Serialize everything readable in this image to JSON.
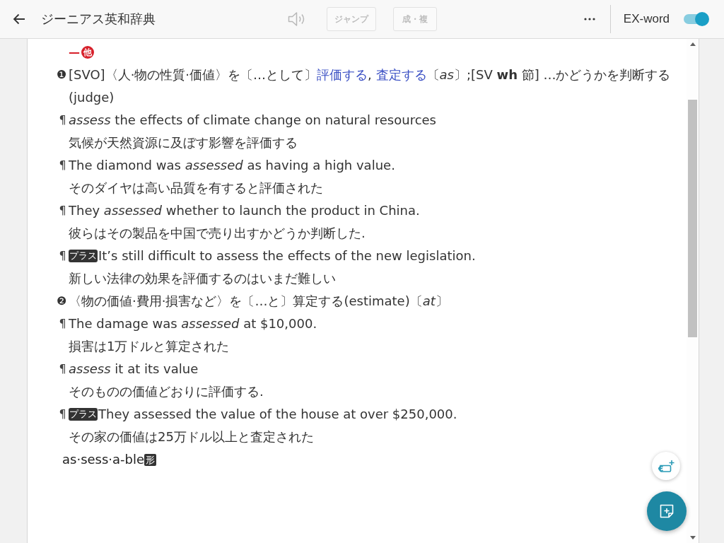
{
  "header": {
    "title": "ジーニアス英和辞典",
    "audio_button": {
      "disabled": true
    },
    "buttons": [
      {
        "label": "ジャンプ",
        "disabled": true
      },
      {
        "label": "成・複",
        "disabled": true
      }
    ],
    "mode_toggle": {
      "label": "EX-word",
      "on": true
    }
  },
  "entry": {
    "pos": {
      "dash": "—",
      "label": "他"
    },
    "blocks": [
      {
        "kind": "sense",
        "number": "❶",
        "segments": [
          {
            "kind": "text",
            "text": "[SVO]〈人·物の性質·価値〉を〔…として〕"
          },
          {
            "kind": "link",
            "text": "評価する"
          },
          {
            "kind": "text",
            "text": ", "
          },
          {
            "kind": "link",
            "text": "査定する"
          },
          {
            "kind": "text",
            "text": "〔*as*〕;[SV **wh** 節] …かどうかを判断する(judge)"
          }
        ]
      },
      {
        "kind": "example",
        "mark": "¶",
        "text": "*assess* the effects of climate change on natural resources",
        "translation": "気候が天然資源に及ぼす影響を評価する"
      },
      {
        "kind": "example",
        "mark": "¶",
        "text": "The diamond was *assessed* as having a high value.",
        "translation": "そのダイヤは高い品質を有すると評価された"
      },
      {
        "kind": "example",
        "mark": "¶",
        "text": "They *assessed* whether to launch the product in China.",
        "translation": "彼らはその製品を中国で売り出すかどうか判断した."
      },
      {
        "kind": "example",
        "mark": "¶",
        "badge": "プラス",
        "text": "It’s still difficult to assess the effects of the new legislation.",
        "translation": "新しい法律の効果を評価するのはいまだ難しい"
      },
      {
        "kind": "sense",
        "number": "❷",
        "segments": [
          {
            "kind": "text",
            "text": "〈物の価値·費用·損害など〉を〔…と〕算定する(estimate)〔*at*〕"
          }
        ]
      },
      {
        "kind": "example",
        "mark": "¶",
        "text": "The damage was *assessed* at $10,000.",
        "translation": "損害は1万ドルと算定された"
      },
      {
        "kind": "example",
        "mark": "¶",
        "text": "*assess* it at its value",
        "translation": "そのものの価値どおりに評価する."
      },
      {
        "kind": "example",
        "mark": "¶",
        "badge": "プラス",
        "text": "They assessed the value of the house at over $250,000.",
        "translation": "その家の価値は25万ドル以上と査定された"
      }
    ],
    "derived": {
      "headword": "as·sess·a-ble",
      "pos": "形"
    }
  }
}
